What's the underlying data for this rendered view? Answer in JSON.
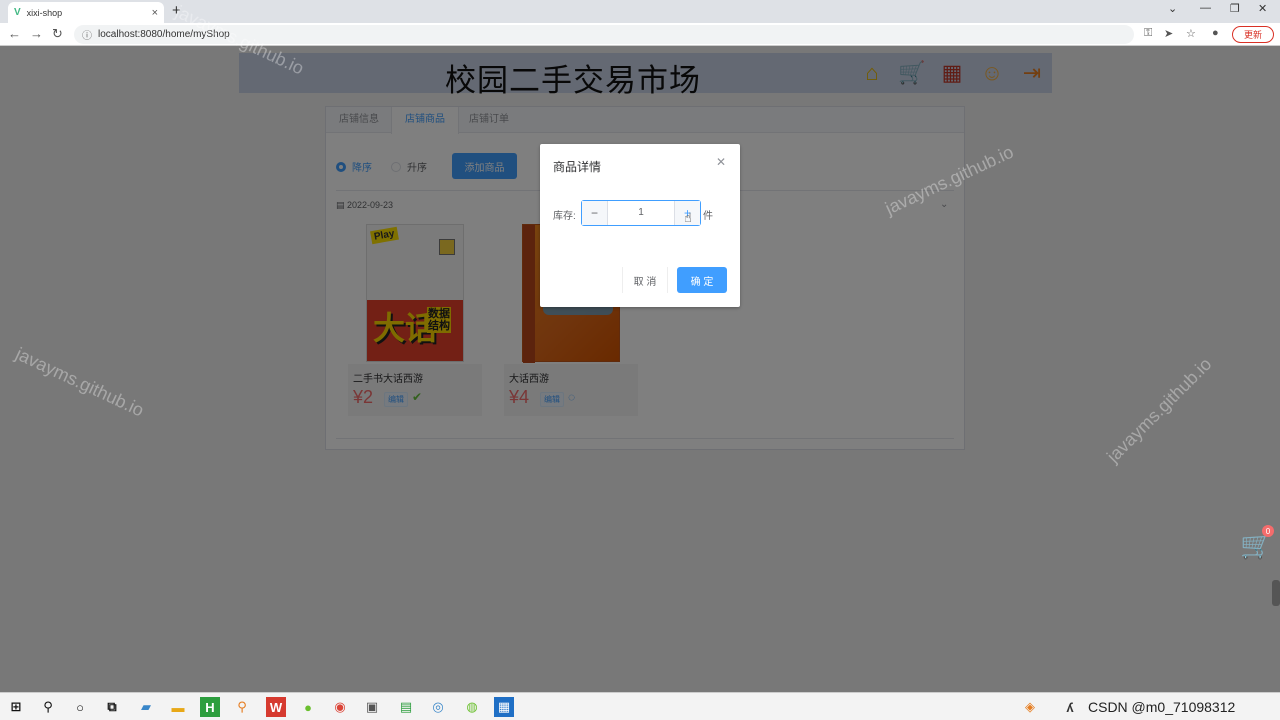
{
  "browser": {
    "tab_title": "xixi-shop",
    "tab_close": "×",
    "new_tab": "+",
    "url": "localhost:8080/home/myShop",
    "update_label": "更新"
  },
  "site": {
    "title": "校园二手交易市场",
    "header_icons": [
      "home-icon",
      "cart-icon",
      "store-icon",
      "avatar-icon",
      "logout-icon"
    ]
  },
  "tabs": [
    "店铺信息",
    "店铺商品",
    "店铺订单"
  ],
  "active_tab": 1,
  "sort": {
    "desc": "降序",
    "asc": "升序",
    "selected": "desc"
  },
  "add_button": "添加商品",
  "date_label": "2022-09-23",
  "products": [
    {
      "name": "二手书大话西游",
      "price": "¥2",
      "tag": "编辑",
      "state_icon": "check-icon"
    },
    {
      "name": "大话西游",
      "price": "¥4",
      "tag": "编辑",
      "state_icon": "loading-icon"
    }
  ],
  "dialog": {
    "title": "商品详情",
    "stock_label": "库存:",
    "stock_value": "1",
    "unit": "件",
    "minus": "−",
    "plus": "+",
    "cancel": "取 消",
    "confirm": "确 定"
  },
  "cart_badge": "0",
  "watermark": "javayms.github.io",
  "taskbar": {
    "csdn_text": "CSDN @m0_71098312"
  },
  "colors": {
    "primary": "#409eff",
    "price": "#f56c6c",
    "header_bg": "#c8d3e6"
  }
}
